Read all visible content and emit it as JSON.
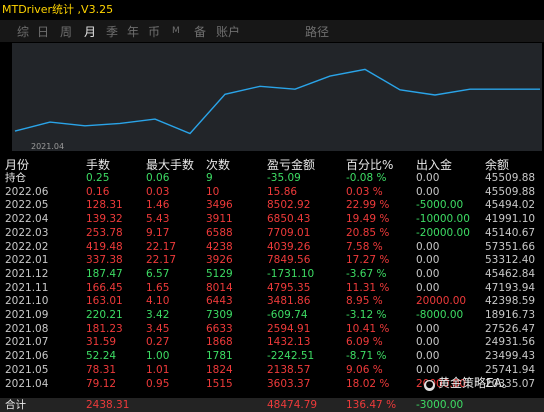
{
  "window": {
    "title": "MTDriver统计 ,V3.25"
  },
  "tabs": [
    {
      "label": "综",
      "active": false
    },
    {
      "label": "日",
      "active": false
    },
    {
      "label": "周",
      "active": false
    },
    {
      "label": "月",
      "active": true
    },
    {
      "label": "季",
      "active": false
    },
    {
      "label": "年",
      "active": false
    },
    {
      "label": "币",
      "active": false
    },
    {
      "label": "M",
      "active": false
    },
    {
      "label": "备",
      "active": false
    },
    {
      "label": "账户",
      "active": false
    },
    {
      "label": "路径",
      "active": false
    }
  ],
  "chart": {
    "x_tick_label": "2021.04",
    "line_color": "#2aa4e8"
  },
  "chart_data": {
    "type": "line",
    "x": [
      "2021.04",
      "2021.05",
      "2021.06",
      "2021.07",
      "2021.08",
      "2021.09",
      "2021.10",
      "2021.11",
      "2021.12",
      "2022.01",
      "2022.02",
      "2022.03",
      "2022.04",
      "2022.05",
      "2022.06",
      "持仓"
    ],
    "series": [
      {
        "values": [
          20335.07,
          25741.94,
          23499.43,
          24931.56,
          27526.47,
          18916.73,
          42398.59,
          47193.94,
          45462.84,
          53312.4,
          57351.66,
          45140.67,
          41991.1,
          45494.02,
          45509.88,
          45509.88
        ]
      }
    ]
  },
  "table": {
    "headers": [
      "月份",
      "手数",
      "最大手数",
      "次数",
      "盈亏金额",
      "百分比%",
      "出入金",
      "余额"
    ],
    "rows": [
      {
        "cells": [
          "持仓",
          "0.25",
          "0.06",
          "9",
          "-35.09",
          "-0.08 %",
          "0.00",
          "45509.88"
        ],
        "status": "hold"
      },
      {
        "cells": [
          "2022.06",
          "0.16",
          "0.03",
          "10",
          "15.86",
          "0.03 %",
          "0.00",
          "45509.88"
        ],
        "status": "profit"
      },
      {
        "cells": [
          "2022.05",
          "128.31",
          "1.46",
          "3496",
          "8502.92",
          "22.99 %",
          "-5000.00",
          "45494.02"
        ],
        "status": "profit"
      },
      {
        "cells": [
          "2022.04",
          "139.32",
          "5.43",
          "3911",
          "6850.43",
          "19.49 %",
          "-10000.00",
          "41991.10"
        ],
        "status": "profit"
      },
      {
        "cells": [
          "2022.03",
          "253.78",
          "9.17",
          "6588",
          "7709.01",
          "20.85 %",
          "-20000.00",
          "45140.67"
        ],
        "status": "profit"
      },
      {
        "cells": [
          "2022.02",
          "419.48",
          "22.17",
          "4238",
          "4039.26",
          "7.58 %",
          "0.00",
          "57351.66"
        ],
        "status": "profit"
      },
      {
        "cells": [
          "2022.01",
          "337.38",
          "22.17",
          "3926",
          "7849.56",
          "17.27 %",
          "0.00",
          "53312.40"
        ],
        "status": "profit"
      },
      {
        "cells": [
          "2021.12",
          "187.47",
          "6.57",
          "5129",
          "-1731.10",
          "-3.67 %",
          "0.00",
          "45462.84"
        ],
        "status": "loss"
      },
      {
        "cells": [
          "2021.11",
          "166.45",
          "1.65",
          "8014",
          "4795.35",
          "11.31 %",
          "0.00",
          "47193.94"
        ],
        "status": "profit"
      },
      {
        "cells": [
          "2021.10",
          "163.01",
          "4.10",
          "6443",
          "3481.86",
          "8.95 %",
          "20000.00",
          "42398.59"
        ],
        "status": "profit"
      },
      {
        "cells": [
          "2021.09",
          "220.21",
          "3.42",
          "7309",
          "-609.74",
          "-3.12 %",
          "-8000.00",
          "18916.73"
        ],
        "status": "loss"
      },
      {
        "cells": [
          "2021.08",
          "181.23",
          "3.45",
          "6633",
          "2594.91",
          "10.41 %",
          "0.00",
          "27526.47"
        ],
        "status": "profit"
      },
      {
        "cells": [
          "2021.07",
          "31.59",
          "0.27",
          "1868",
          "1432.13",
          "6.09 %",
          "0.00",
          "24931.56"
        ],
        "status": "profit"
      },
      {
        "cells": [
          "2021.06",
          "52.24",
          "1.00",
          "1781",
          "-2242.51",
          "-8.71 %",
          "0.00",
          "23499.43"
        ],
        "status": "loss"
      },
      {
        "cells": [
          "2021.05",
          "78.31",
          "1.01",
          "1824",
          "2138.57",
          "9.06 %",
          "0.00",
          "25741.94"
        ],
        "status": "profit"
      },
      {
        "cells": [
          "2021.04",
          "79.12",
          "0.95",
          "1515",
          "3603.37",
          "18.02 %",
          "20000.00",
          "20335.07"
        ],
        "status": "profit"
      }
    ],
    "total": {
      "cells": [
        "合计",
        "2438.31",
        "",
        "",
        "48474.79",
        "136.47 %",
        "-3000.00",
        ""
      ]
    }
  },
  "watermark": {
    "icon": "wechat-icon",
    "text": "黄金策略EA。"
  },
  "colors": {
    "profit": "#ee3a3a",
    "loss": "#3ddc64",
    "title": "#ffd400",
    "line": "#2aa4e8"
  }
}
